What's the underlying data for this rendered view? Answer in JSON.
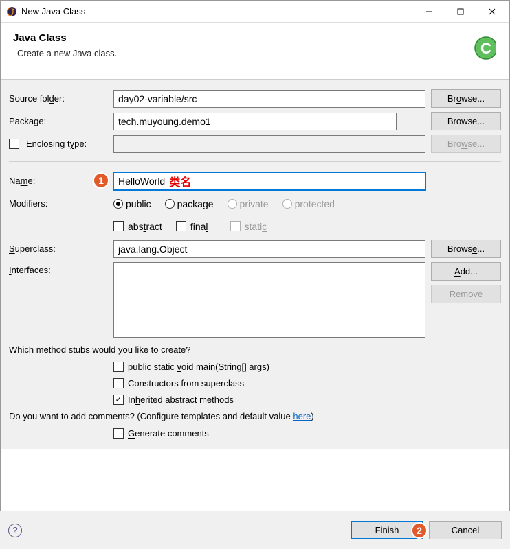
{
  "window": {
    "title": "New Java Class",
    "minimize": "—",
    "maximize": "☐",
    "close": "✕"
  },
  "header": {
    "title": "Java Class",
    "subtitle": "Create a new Java class."
  },
  "fields": {
    "source_folder_label": "Source folder:",
    "source_folder_value": "day02-variable/src",
    "package_label": "Package:",
    "package_value": "tech.muyoung.demo1",
    "enclosing_label": "Enclosing type:",
    "name_label": "Name:",
    "name_value": "HelloWorld",
    "name_annotation": "类名",
    "modifiers_label": "Modifiers:",
    "superclass_label": "Superclass:",
    "superclass_value": "java.lang.Object",
    "interfaces_label": "Interfaces:"
  },
  "buttons": {
    "browse": "Browse...",
    "add": "Add...",
    "remove": "Remove",
    "finish": "Finish",
    "cancel": "Cancel"
  },
  "modifiers": {
    "public": "public",
    "package": "package",
    "private": "private",
    "protected": "protected",
    "abstract": "abstract",
    "final": "final",
    "static": "static"
  },
  "stubs": {
    "question": "Which method stubs would you like to create?",
    "main": "public static void main(String[] args)",
    "constructors": "Constructors from superclass",
    "inherited": "Inherited abstract methods"
  },
  "comments": {
    "question_prefix": "Do you want to add comments? (Configure templates and default value ",
    "link": "here",
    "question_suffix": ")",
    "generate": "Generate comments"
  },
  "annotations": {
    "badge1": "1",
    "badge2": "2"
  }
}
